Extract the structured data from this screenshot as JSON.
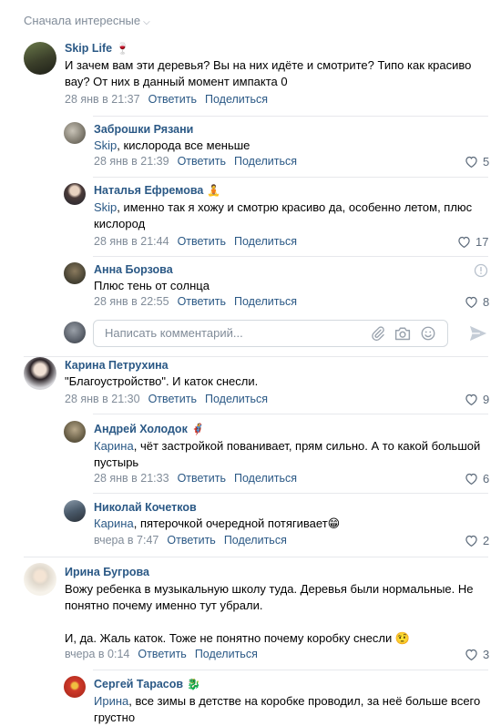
{
  "sort_label": "Сначала интересные",
  "actions": {
    "reply": "Ответить",
    "share": "Поделиться"
  },
  "comments": [
    {
      "author": "Skip Life",
      "author_emoji": "🍷",
      "lines": [
        "И зачем вам эти деревья? Вы на них идёте и смотрите? Типо как красиво",
        "вау? От них в данный момент импакта 0"
      ],
      "date": "28 янв в 21:37"
    },
    {
      "author": "Заброшки Рязани",
      "mention": "Skip",
      "text": ", кислорода все меньше",
      "date": "28 янв в 21:39",
      "likes": "5"
    },
    {
      "author": "Наталья Ефремова",
      "author_emoji": "🧘",
      "mention": "Skip",
      "text": ", именно так я хожу и смотрю красиво да, особенно летом, плюс",
      "text2": "кислород",
      "date": "28 янв в 21:44",
      "likes": "17"
    },
    {
      "author": "Анна Борзова",
      "text": "Плюс тень от солнца",
      "date": "28 янв в 22:55",
      "likes": "8"
    },
    {
      "author": "Карина Петрухина",
      "text": "\"Благоустройство\". И каток снесли.",
      "date": "28 янв в 21:30",
      "likes": "9"
    },
    {
      "author": "Андрей Холодок",
      "author_emoji": "🦸",
      "mention": "Карина",
      "text": ", чёт застройкой пованивает, прям сильно. А то какой большой",
      "text2": "пустырь",
      "date": "28 янв в 21:33",
      "likes": "6"
    },
    {
      "author": "Николай Кочетков",
      "mention": "Карина",
      "text": ", пятерочкой очередной потягивает😁",
      "date": "вчера в 7:47",
      "likes": "2"
    },
    {
      "author": "Ирина Бугрова",
      "lines": [
        "Вожу ребенка в музыкальную школу туда. Деревья были нормальные. Не",
        "понятно почему именно тут убрали.",
        "",
        "И, да. Жаль каток. Тоже не понятно почему коробку снесли 🤨"
      ],
      "date": "вчера в 0:14",
      "likes": "3"
    },
    {
      "author": "Сергей Тарасов",
      "author_emoji": "🐉",
      "mention": "Ирина",
      "text": ", все зимы в детстве на коробке проводил, за неё больше всего",
      "text2": "грустно"
    }
  ],
  "reply_input": {
    "placeholder": "Написать комментарий..."
  },
  "colors": {
    "link": "#2a5885",
    "meta": "#818c99",
    "separator": "#e7e8ec"
  }
}
